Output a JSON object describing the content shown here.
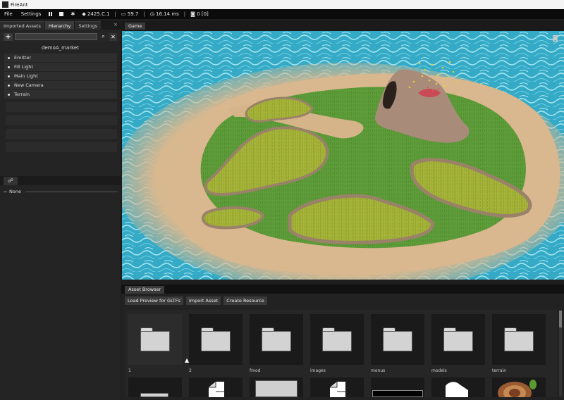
{
  "window": {
    "title": "FireAnt"
  },
  "menu": {
    "file": "File",
    "settings": "Settings",
    "version": "2425.C.1",
    "fps": "59.7",
    "frame_time": "16.14 ms",
    "capture_count": "0 [0]",
    "separator": "|"
  },
  "left_panel": {
    "tabs": [
      "Imported Assets",
      "Hierarchy",
      "Settings"
    ],
    "active_tab": "Hierarchy",
    "close_label": "×",
    "root_name": "demoA_market",
    "items": [
      "Emitter",
      "Fill Light",
      "Main Light",
      "New Camera",
      "Terrain"
    ],
    "inspector_selection": "None"
  },
  "game": {
    "tab_label": "Game"
  },
  "asset_browser": {
    "tab_label": "Asset Browser",
    "buttons": [
      "Load Preview for GLTFs",
      "Import Asset",
      "Create Resource"
    ],
    "folders": [
      "1",
      "2",
      "fmod",
      "images",
      "menus",
      "models",
      "terrain"
    ]
  },
  "colors": {
    "menubar": "#0b0b0b",
    "panel": "#242424",
    "water": "#3fb7d0",
    "sand": "#d9b88f",
    "grass": "#5d9a38",
    "grass_yellow": "#a8b83a",
    "rock": "#a88c79"
  }
}
